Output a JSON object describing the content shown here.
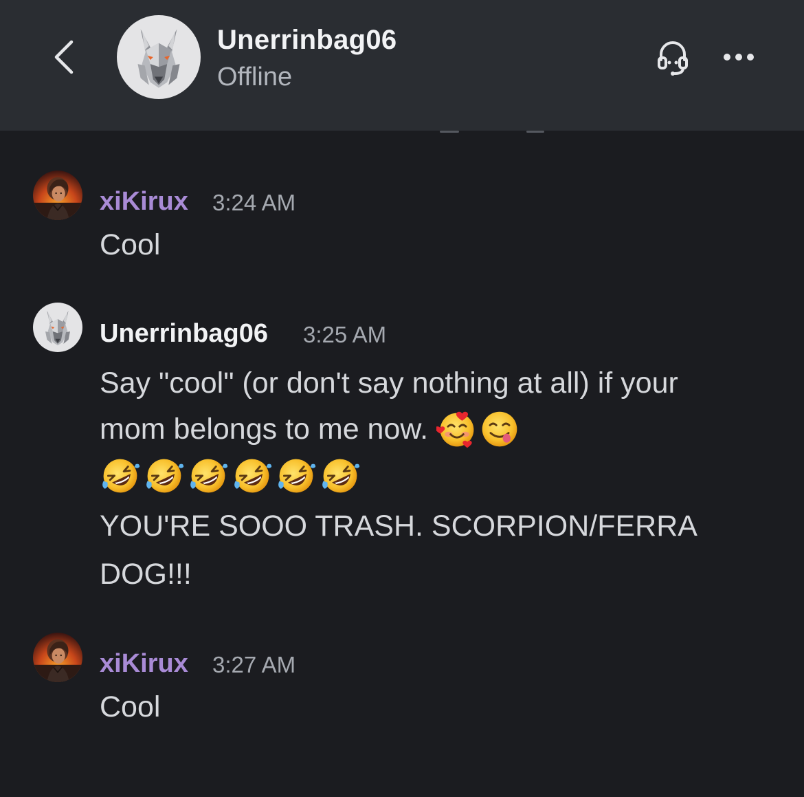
{
  "header": {
    "contact_name": "Unerrinbag06",
    "status": "Offline",
    "back_icon": "chevron-left-icon",
    "support_icon": "headset-icon",
    "more_icon": "ellipsis-icon"
  },
  "colors": {
    "background": "#1b1c20",
    "header_bg": "#2a2d32",
    "xikirux_name": "#a98bd6",
    "unerrinbag_name": "#f2f3f5",
    "message_text": "#d6d8dc",
    "timestamp": "#a5a9b0"
  },
  "messages": [
    {
      "author": "xiKirux",
      "time": "3:24 AM",
      "lines": [
        "Cool"
      ]
    },
    {
      "author": "Unerrinbag06",
      "time": "3:25 AM",
      "lines": [
        "Say \"cool\" (or don't say nothing at all) if your",
        "mom belongs to me now.",
        "YOU'RE SOOO TRASH. SCORPION/FERRA",
        "DOG!!!"
      ],
      "emojis_inline": [
        "smiling-face-with-hearts",
        "face-savoring-food"
      ],
      "emojis_row": [
        "rolling-on-floor-laughing",
        "rolling-on-floor-laughing",
        "rolling-on-floor-laughing",
        "rolling-on-floor-laughing",
        "rolling-on-floor-laughing",
        "rolling-on-floor-laughing"
      ]
    },
    {
      "author": "xiKirux",
      "time": "3:27 AM",
      "lines": [
        "Cool"
      ]
    }
  ]
}
